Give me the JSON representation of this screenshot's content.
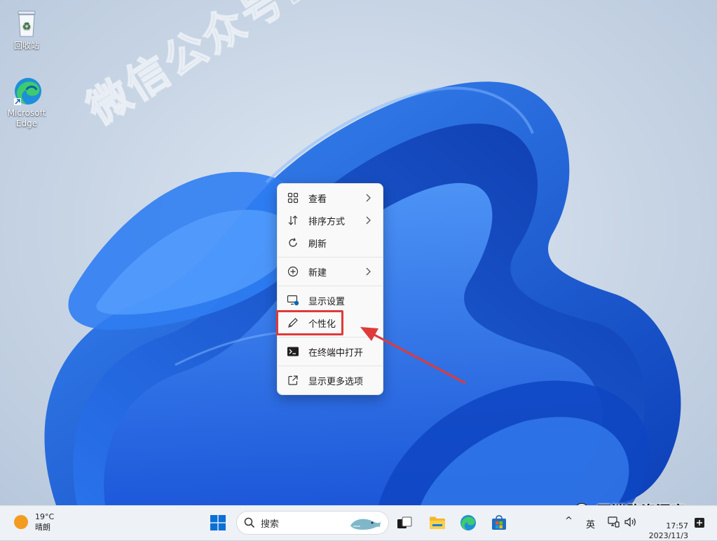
{
  "desktop": {
    "icons": [
      {
        "label": "回收站"
      },
      {
        "label_line1": "Microsoft",
        "label_line2": "Edge"
      }
    ],
    "watermark": "微信公众号: 不迷路资源库"
  },
  "context_menu": {
    "items": [
      {
        "label": "查看",
        "icon": "grid-icon",
        "submenu": true
      },
      {
        "label": "排序方式",
        "icon": "sort-icon",
        "submenu": true
      },
      {
        "label": "刷新",
        "icon": "refresh-icon",
        "submenu": false
      },
      {
        "label": "新建",
        "icon": "plus-circle-icon",
        "submenu": true
      },
      {
        "label": "显示设置",
        "icon": "display-settings-icon",
        "submenu": false
      },
      {
        "label": "个性化",
        "icon": "pen-icon",
        "submenu": false,
        "highlighted": true
      },
      {
        "label": "在终端中打开",
        "icon": "terminal-icon",
        "submenu": false
      },
      {
        "label": "显示更多选项",
        "icon": "open-external-icon",
        "submenu": false
      }
    ]
  },
  "annotation": {
    "box_color": "#e03a3a",
    "arrow_color": "#e03a3a"
  },
  "taskbar": {
    "weather": {
      "temp": "19°C",
      "condition": "晴朗"
    },
    "search": {
      "placeholder": "搜索"
    },
    "tray": {
      "ime": "英",
      "chevron": "^"
    },
    "clock": {
      "time": "17:57",
      "date": "2023/11/3"
    },
    "brand": "不迷路资源库"
  },
  "colors": {
    "accent": "#0067c0",
    "wallpaper_blue": "#1f63e0"
  }
}
